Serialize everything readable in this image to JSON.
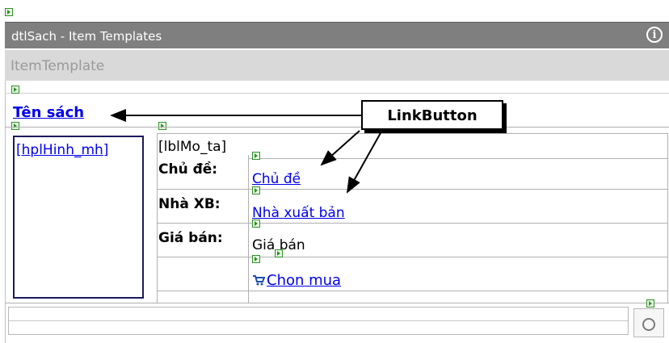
{
  "designer": {
    "title": "dtlSach - Item Templates",
    "template_header": "ItemTemplate",
    "info_icon": "info-icon"
  },
  "template": {
    "ten_sach": "Tên sách",
    "hinh": "[hplHinh_mh]",
    "mo_ta": "[lblMo_ta]",
    "chu_de_label": "Chủ đề:",
    "chu_de_link": "Chủ đề",
    "nxb_label": "Nhà XB:",
    "nxb_link": "Nhà xuất bản",
    "gia_label": "Giá bán:",
    "gia_value": "Giá bán",
    "chon_mua": "Chon mua",
    "cart_icon": "cart-icon"
  },
  "callout": {
    "label": "LinkButton"
  }
}
